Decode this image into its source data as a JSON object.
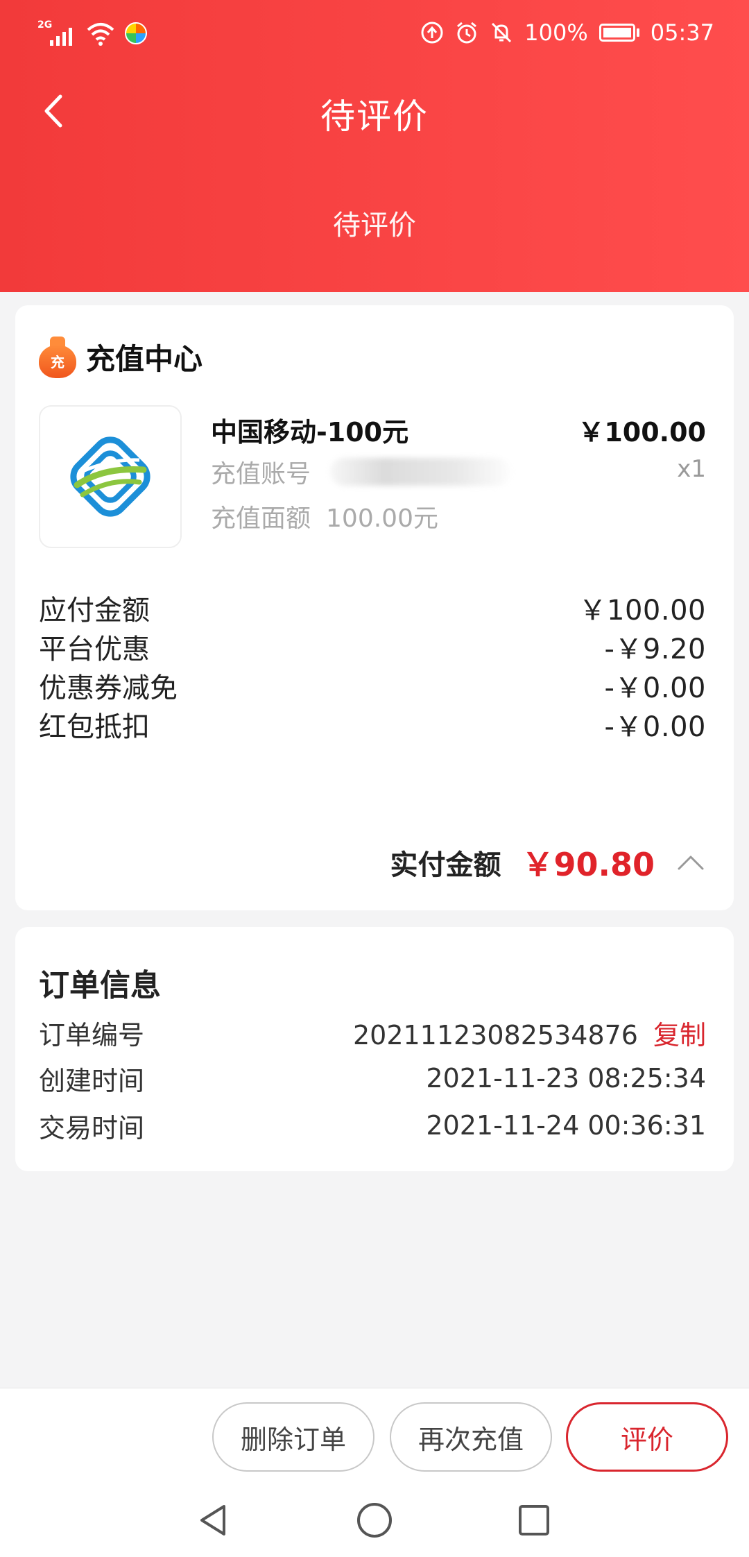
{
  "status_bar": {
    "network": "2G",
    "battery": "100%",
    "time": "05:37"
  },
  "nav": {
    "title": "待评价"
  },
  "order_status": "待评价",
  "shop": {
    "name": "充值中心",
    "icon_text": "充"
  },
  "product": {
    "name": "中国移动-100元",
    "price": "￥100.00",
    "quantity": "x1",
    "account_label": "充值账号",
    "face_label": "充值面额",
    "face_value": "100.00元"
  },
  "fees": [
    {
      "label": "应付金额",
      "value": "￥100.00"
    },
    {
      "label": "平台优惠",
      "value": "-￥9.20"
    },
    {
      "label": "优惠券减免",
      "value": "-￥0.00"
    },
    {
      "label": "红包抵扣",
      "value": "-￥0.00"
    }
  ],
  "total": {
    "label": "实付金额",
    "value": "￥90.80"
  },
  "order_info": {
    "title": "订单信息",
    "order_no_label": "订单编号",
    "order_no": "20211123082534876",
    "copy_label": "复制",
    "created_label": "创建时间",
    "created": "2021-11-23 08:25:34",
    "trade_label": "交易时间",
    "trade": "2021-11-24 00:36:31"
  },
  "actions": {
    "delete": "删除订单",
    "recharge_again": "再次充值",
    "review": "评价"
  },
  "colors": {
    "header_red": "#f23a3a",
    "accent_red": "#e0232a",
    "background": "#f4f4f5"
  }
}
